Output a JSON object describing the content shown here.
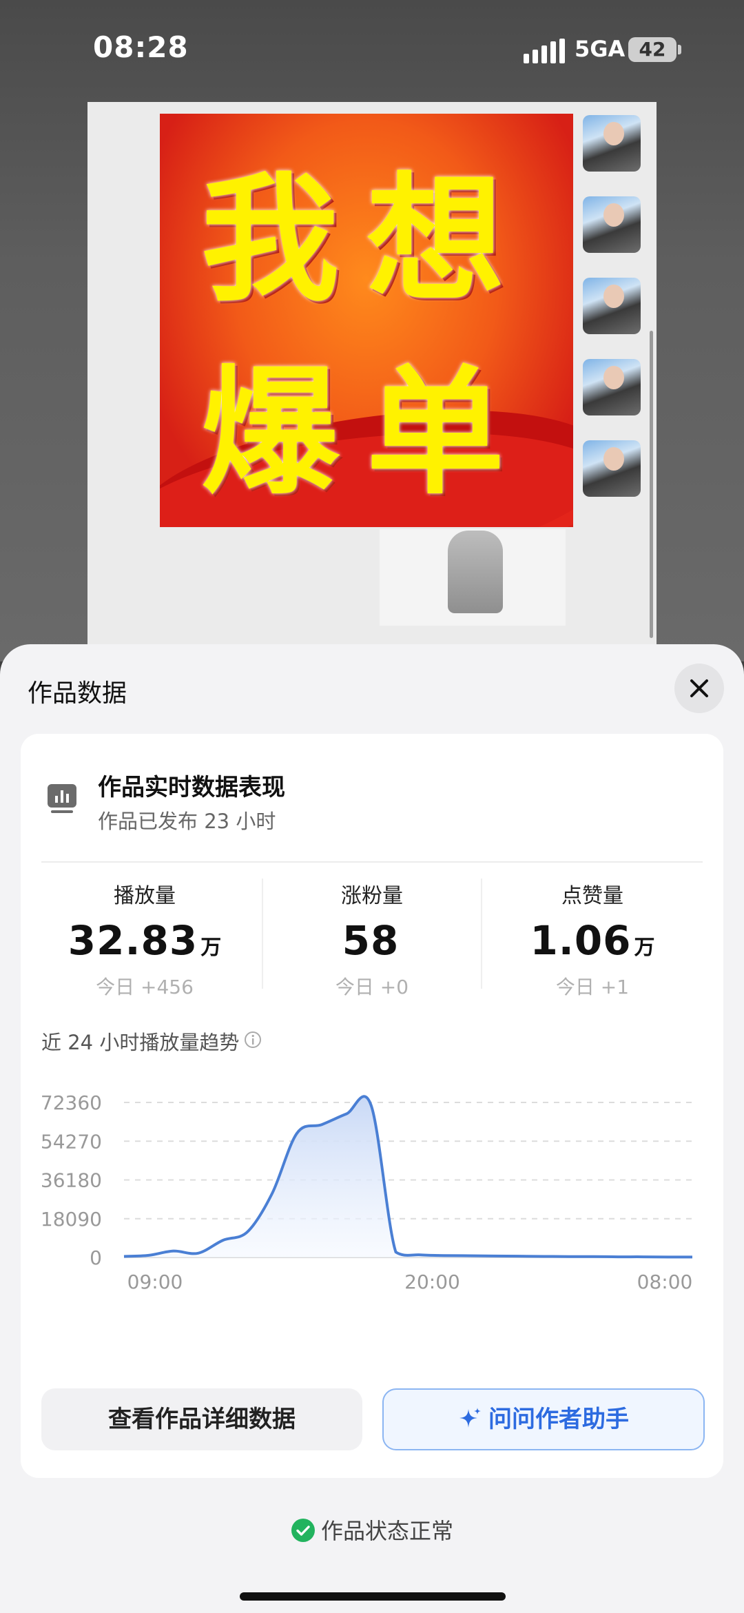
{
  "status_bar": {
    "time": "08:28",
    "network": "5GA",
    "battery": "42"
  },
  "poster": {
    "line1": "我想",
    "line2": "爆单"
  },
  "sheet": {
    "title": "作品数据",
    "card": {
      "title": "作品实时数据表现",
      "subtitle": "作品已发布 23 小时",
      "metrics": [
        {
          "label": "播放量",
          "value": "32.83",
          "unit": "万",
          "delta": "今日 +456"
        },
        {
          "label": "涨粉量",
          "value": "58",
          "unit": "",
          "delta": "今日 +0"
        },
        {
          "label": "点赞量",
          "value": "1.06",
          "unit": "万",
          "delta": "今日 +1"
        }
      ],
      "trend_title": "近 24 小时播放量趋势"
    },
    "buttons": {
      "detail": "查看作品详细数据",
      "assistant": "问问作者助手"
    },
    "status_text": "作品状态正常"
  },
  "colors": {
    "accent": "#2d6be0",
    "line": "#4a7fd4",
    "ok": "#22b35e"
  },
  "chart_data": {
    "type": "area",
    "title": "近 24 小时播放量趋势",
    "ylim": [
      0,
      72360
    ],
    "yticks": [
      "72360",
      "54270",
      "36180",
      "18090",
      "0"
    ],
    "xticks": [
      "09:00",
      "20:00",
      "08:00"
    ],
    "x": [
      "09:00",
      "10:00",
      "11:00",
      "12:00",
      "13:00",
      "14:00",
      "15:00",
      "16:00",
      "17:00",
      "18:00",
      "19:00",
      "20:00",
      "21:00",
      "22:00",
      "23:00",
      "00:00",
      "01:00",
      "02:00",
      "03:00",
      "04:00",
      "05:00",
      "06:00",
      "07:00",
      "08:00"
    ],
    "series": [
      {
        "values": [
          500,
          1000,
          3000,
          2000,
          8000,
          12000,
          30000,
          58000,
          62000,
          67000,
          71000,
          2500,
          1200,
          900,
          800,
          700,
          600,
          500,
          400,
          400,
          300,
          300,
          200,
          200
        ]
      }
    ],
    "grid": true,
    "legend": "none"
  }
}
